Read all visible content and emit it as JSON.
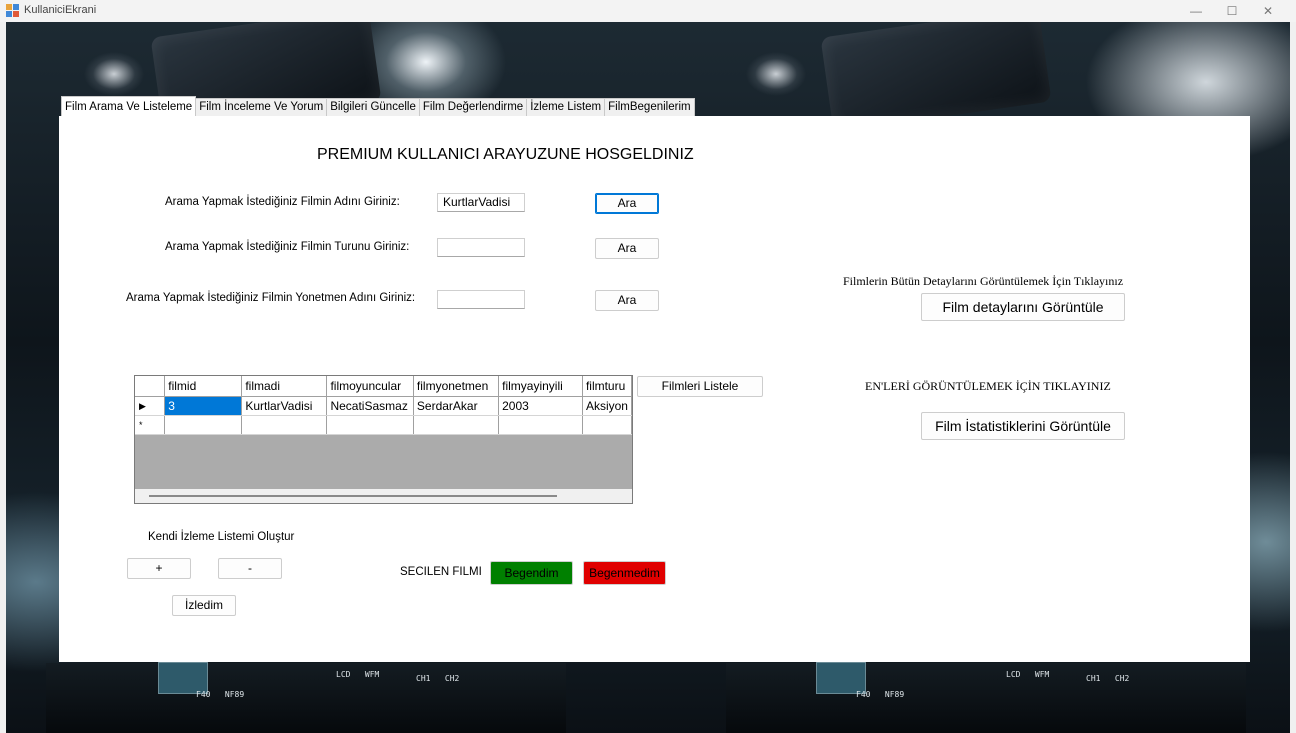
{
  "window": {
    "title": "KullaniciEkrani",
    "controls": [
      "—",
      "☐",
      "✕"
    ]
  },
  "tabs": [
    {
      "label": "Film Arama Ve Listeleme",
      "active": true
    },
    {
      "label": "Film İnceleme Ve Yorum",
      "active": false
    },
    {
      "label": "Bilgileri Güncelle",
      "active": false
    },
    {
      "label": "Film Değerlendirme",
      "active": false
    },
    {
      "label": "İzleme Listem",
      "active": false
    },
    {
      "label": "FilmBegenilerim",
      "active": false
    }
  ],
  "main": {
    "heading": "PREMIUM KULLANICI ARAYUZUNE HOSGELDINIZ",
    "search_name_label": "Arama Yapmak İstediğiniz Filmin Adını Giriniz:",
    "search_name_value": "KurtlarVadisi",
    "search_genre_label": "Arama Yapmak İstediğiniz Filmin Turunu Giriniz:",
    "search_genre_value": "",
    "search_director_label": "Arama Yapmak İstediğiniz Filmin Yonetmen Adını Giriniz:",
    "search_director_value": "",
    "search_button": "Ara",
    "details_prompt": "Filmlerin Bütün Detaylarını Görüntülemek İçin Tıklayınız",
    "details_button": "Film detaylarını Görüntüle",
    "list_button": "Filmleri Listele",
    "best_prompt": "EN'LERİ GÖRÜNTÜLEMEK İÇİN TIKLAYINIZ",
    "stats_button": "Film İstatistiklerini Görüntüle",
    "watchlist_label": "Kendi İzleme Listemi Oluştur",
    "add_button": "+",
    "remove_button": "-",
    "watched_button": "İzledim",
    "selected_label": "SECILEN FILMI",
    "like_button": "Begendim",
    "dislike_button": "Begenmedim"
  },
  "grid": {
    "columns": [
      "filmid",
      "filmadi",
      "filmoyuncular",
      "filmyonetmen",
      "filmyayinyili",
      "filmturu"
    ],
    "rows": [
      {
        "marker": "▶",
        "cells": [
          "3",
          "KurtlarVadisi",
          "NecatiSasmaz",
          "SerdarAkar",
          "2003",
          "Aksiyon"
        ]
      },
      {
        "marker": "*",
        "cells": [
          "",
          "",
          "",
          "",
          "",
          ""
        ]
      }
    ]
  },
  "colors": {
    "accent": "#0078d7",
    "like": "#008000",
    "dislike": "#e00000"
  }
}
